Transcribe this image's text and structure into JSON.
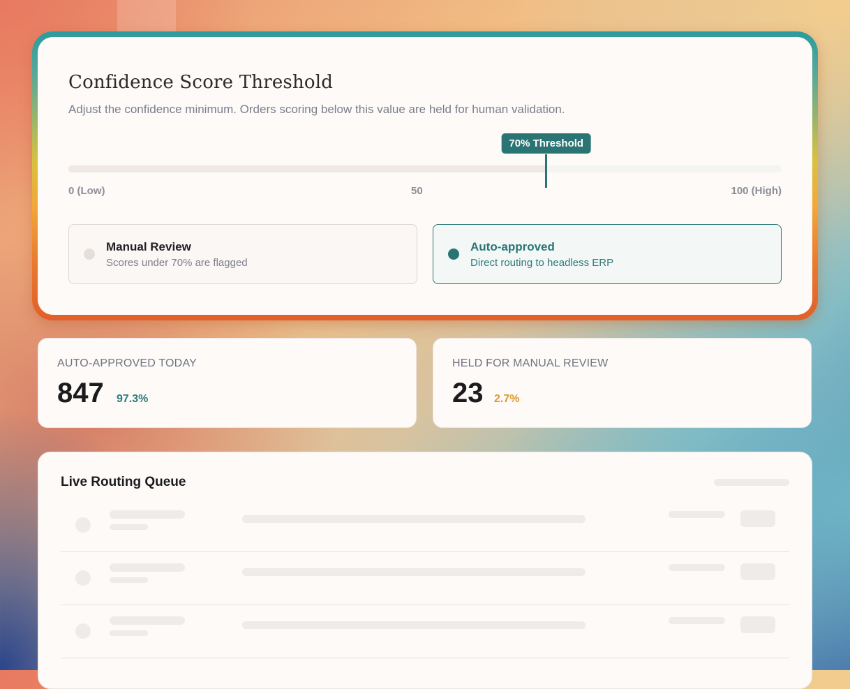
{
  "threshold": {
    "title": "Confidence Score Threshold",
    "subtitle": "Adjust the confidence minimum. Orders scoring below this value are held for human validation.",
    "value_percent": 67,
    "badge_label": "70% Threshold",
    "ticks": {
      "low": "0 (Low)",
      "mid": "50",
      "high": "100 (High)"
    },
    "options": {
      "manual": {
        "label": "Manual Review",
        "description": "Scores under 70% are flagged"
      },
      "auto": {
        "label": "Auto-approved",
        "description": "Direct routing to headless ERP"
      }
    }
  },
  "stats": {
    "auto": {
      "label": "AUTO-APPROVED TODAY",
      "value": "847",
      "percent": "97.3%"
    },
    "held": {
      "label": "HELD FOR MANUAL REVIEW",
      "value": "23",
      "percent": "2.7%"
    }
  },
  "queue": {
    "title": "Live Routing Queue",
    "rows_loading": 3
  },
  "colors": {
    "accent": "#2a7574",
    "warning": "#e0982e",
    "card_bg": "#fdfaf8"
  }
}
